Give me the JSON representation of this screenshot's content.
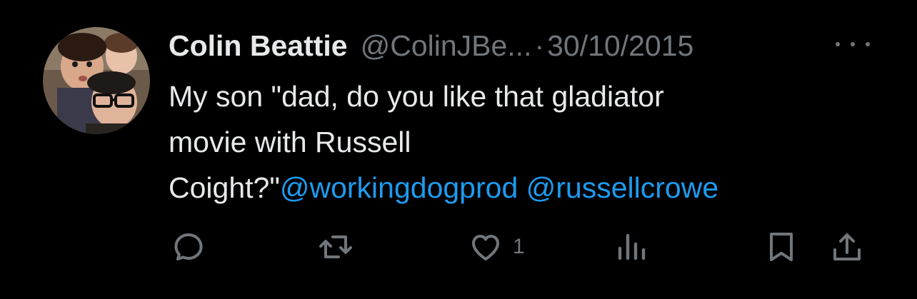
{
  "tweet": {
    "author_name": "Colin Beattie",
    "handle": "@ColinJBe...",
    "separator": "·",
    "date": "30/10/2015",
    "text_line1": "My son \"dad, do you like that gladiator",
    "text_line2": "movie with Russell",
    "text_line3_prefix": "Coight?\"",
    "mention1": "@workingdogprod",
    "mention2": "@russellcrowe"
  },
  "actions": {
    "reply_icon": "reply-icon",
    "retweet_icon": "retweet-icon",
    "like_icon": "heart-icon",
    "like_count": "1",
    "views_icon": "bar-chart-icon",
    "bookmark_icon": "bookmark-icon",
    "share_icon": "share-icon"
  },
  "colors": {
    "background": "#000000",
    "text": "#e7e9ea",
    "muted": "#71767b",
    "link": "#1d9bf0"
  }
}
